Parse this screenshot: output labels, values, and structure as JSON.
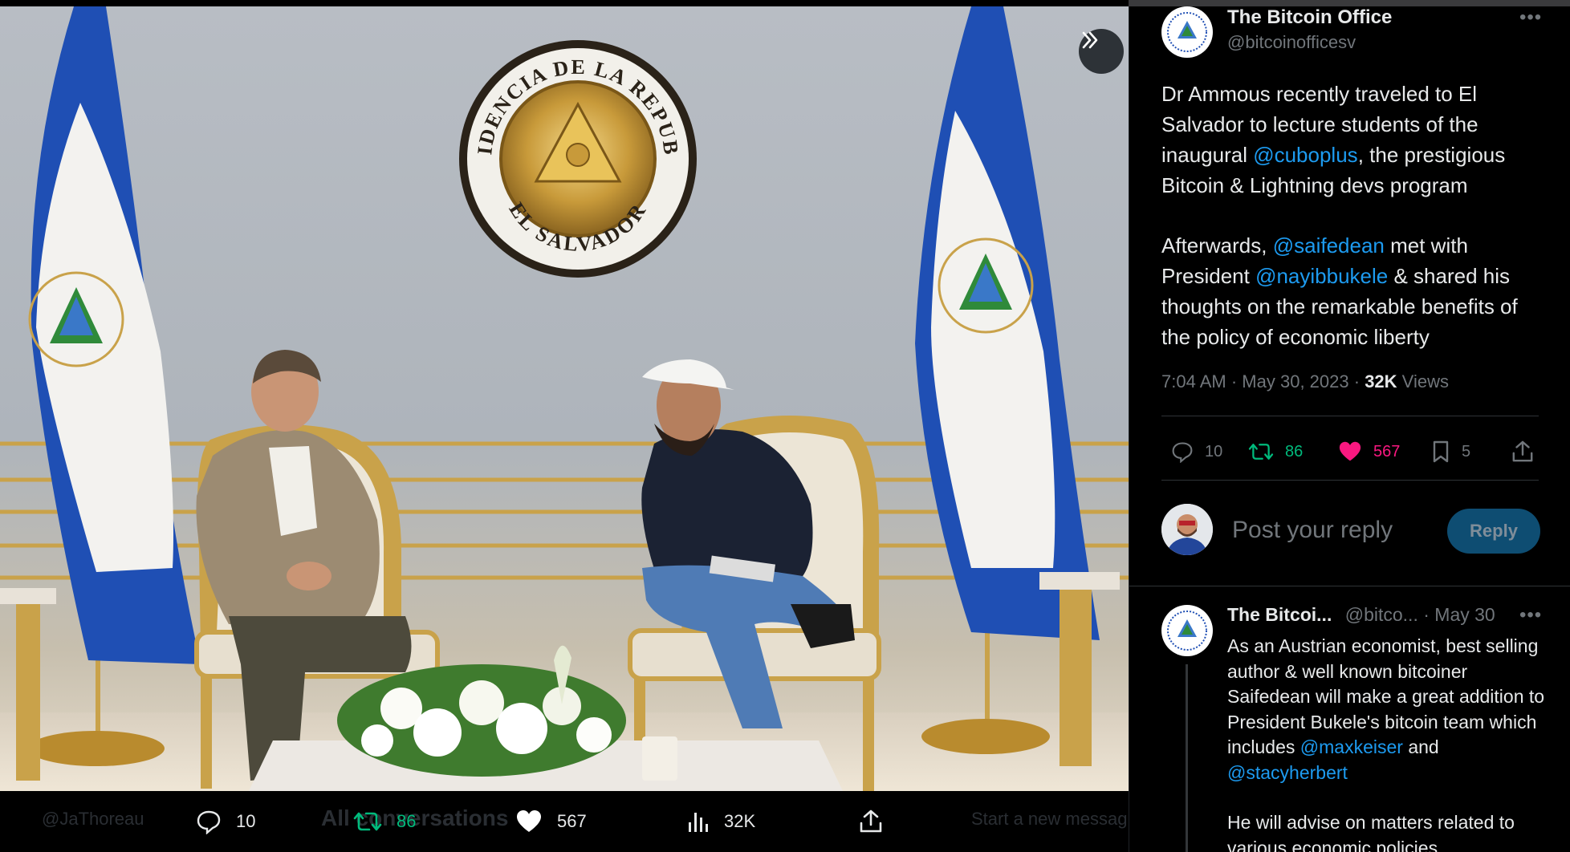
{
  "media_bar": {
    "reply_count": "10",
    "retweet_count": "86",
    "like_count": "567",
    "views_count": "32K",
    "ghost_handle": "@JaThoreau",
    "ghost_conversations": "All conversations",
    "ghost_message": "Start a new messag"
  },
  "tweet": {
    "author_name": "The Bitcoin Office",
    "author_handle": "@bitcoinofficesv",
    "paragraph1": {
      "t1": "Dr Ammous recently traveled to El Salvador to lecture students of the inaugural ",
      "m1": "@cuboplus",
      "t2": ", the prestigious Bitcoin & Lightning devs program"
    },
    "paragraph2": {
      "t1": "Afterwards, ",
      "m1": "@saifedean",
      "t2": " met with President ",
      "m2": "@nayibbukele",
      "t3": " & shared his thoughts on the remarkable benefits of the policy of economic liberty"
    },
    "time": "7:04 AM",
    "date": "May 30, 2023",
    "views": "32K",
    "views_label": "Views",
    "reply_count": "10",
    "retweet_count": "86",
    "like_count": "567",
    "bookmark_count": "5"
  },
  "reply_composer": {
    "placeholder": "Post your reply",
    "button_label": "Reply"
  },
  "reply_tweet": {
    "author_name": "The Bitcoi...",
    "author_handle": "@bitco...",
    "date": "May 30",
    "paragraph1": {
      "t1": "As an Austrian economist, best selling author & well known bitcoiner Saifedean will make a great addition to President Bukele's bitcoin team which includes ",
      "m1": "@maxkeiser",
      "t2": " and ",
      "m2": "@stacyherbert"
    },
    "paragraph2": "He will advise on matters related to various economic policies"
  },
  "photo": {
    "seal_top_text": "PRESIDENCIA DE LA REPUBLICA",
    "seal_bottom_text": "EL SALVADOR"
  },
  "colors": {
    "accent": "#1d9bf0",
    "retweet": "#00ba7c",
    "like": "#f91880",
    "muted": "#71767b"
  }
}
